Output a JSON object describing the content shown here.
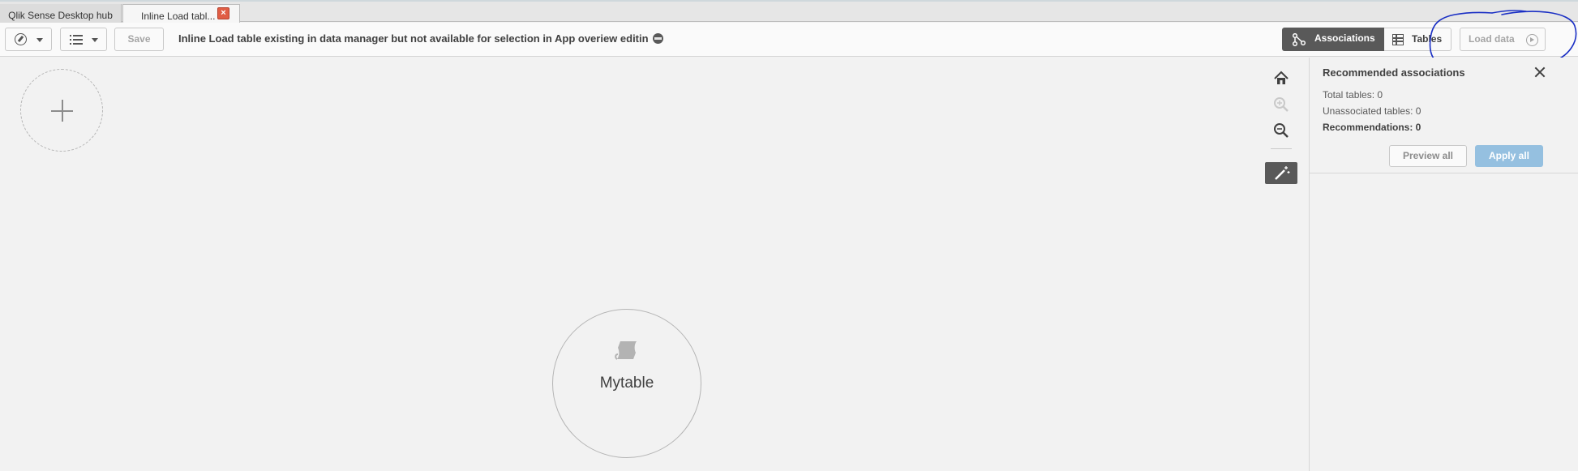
{
  "tabs": [
    {
      "label": "Qlik Sense Desktop hub"
    },
    {
      "label": "Inline Load tabl..."
    }
  ],
  "toolbar": {
    "save_label": "Save",
    "app_title": "Inline Load table existing in data manager but not available for selection in App overiew editin",
    "associations_label": "Associations",
    "tables_label": "Tables",
    "load_data_label": "Load data"
  },
  "canvas": {
    "table_name": "Mytable"
  },
  "panel": {
    "title": "Recommended associations",
    "total_tables": "Total tables: 0",
    "unassociated_tables": "Unassociated tables: 0",
    "recommendations": "Recommendations: 0",
    "preview_all_label": "Preview all",
    "apply_all_label": "Apply all"
  },
  "colors": {
    "accent_active": "#595959",
    "apply_button": "#95c0e0",
    "tab_close": "#e05d44",
    "annotation_ink": "#1a2fc4"
  }
}
